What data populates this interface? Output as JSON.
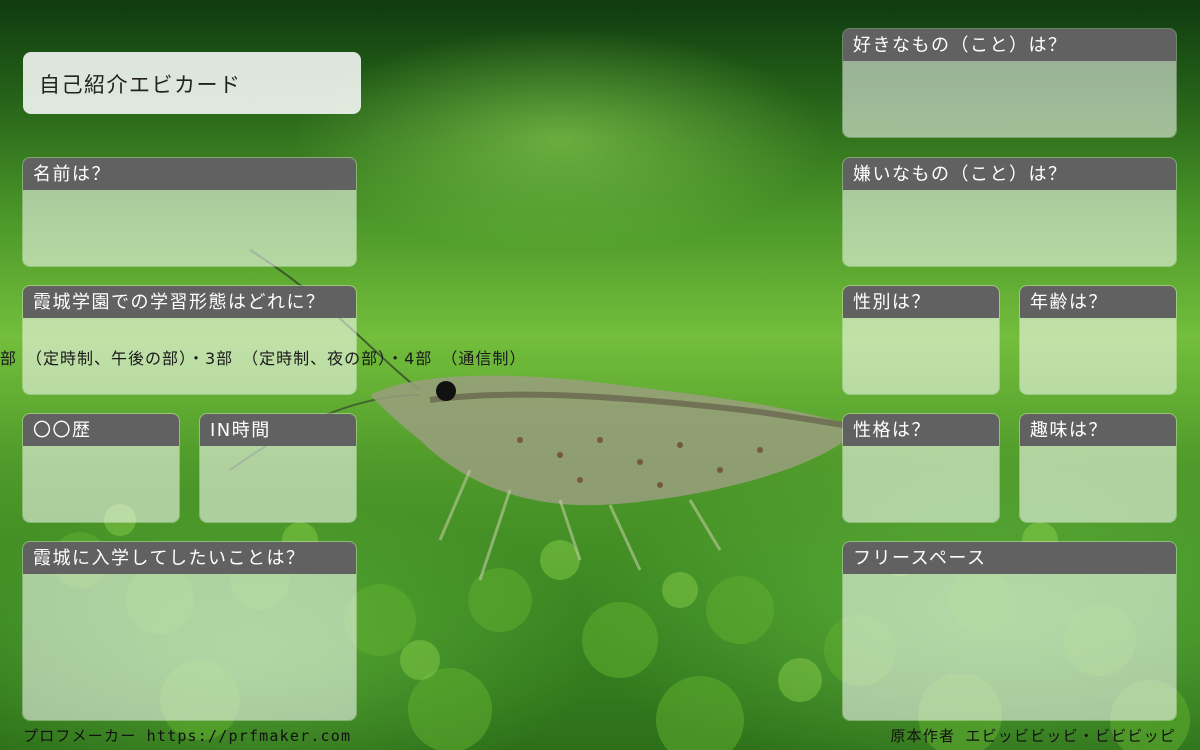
{
  "card": {
    "title": "自己紹介エビカード"
  },
  "left_fields": {
    "name": "名前は？",
    "study_style": "霞城学園での学習形態はどれに？",
    "study_options": "部　（定時制、午後の部）・3部　（定時制、夜の部）・4部　（通信制）",
    "history": "〇〇歴",
    "in_time": "IN時間",
    "want_to_do": "霞城に入学してしたいことは？"
  },
  "right_fields": {
    "likes": "好きなもの（こと）は？",
    "dislikes": "嫌いなもの（こと）は？",
    "gender": "性別は？",
    "age": "年齢は？",
    "personality": "性格は？",
    "hobby": "趣味は？",
    "free_space": "フリースペース"
  },
  "footer": {
    "maker": "プロフメーカー https://prfmaker.com",
    "credit": "原本作者 エビッビビッビ・ビビビッピ"
  },
  "colors": {
    "header_bar": "#616161",
    "panel_fill": "rgba(255,255,255,0.55)",
    "background_green": "#74be3c"
  }
}
